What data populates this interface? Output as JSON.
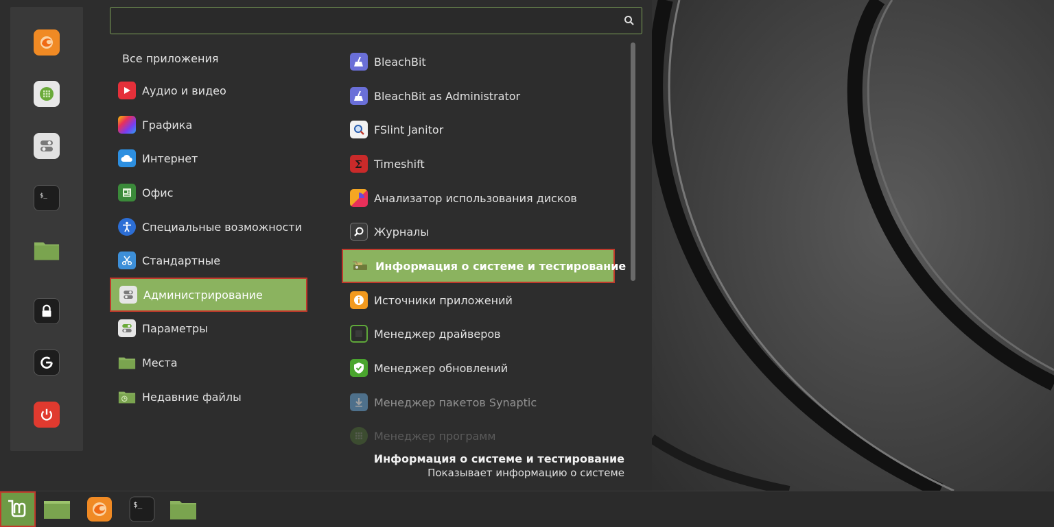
{
  "search": {
    "value": "",
    "placeholder": ""
  },
  "all_apps_label": "Все приложения",
  "categories": [
    {
      "label": "Аудио и видео",
      "icon": "play-icon"
    },
    {
      "label": "Графика",
      "icon": "graphics-icon"
    },
    {
      "label": "Интернет",
      "icon": "cloud-icon"
    },
    {
      "label": "Офис",
      "icon": "office-icon"
    },
    {
      "label": "Специальные возможности",
      "icon": "accessibility-icon"
    },
    {
      "label": "Стандартные",
      "icon": "scissors-icon"
    },
    {
      "label": "Администрирование",
      "icon": "admin-icon",
      "selected": true
    },
    {
      "label": "Параметры",
      "icon": "settings-icon"
    },
    {
      "label": "Места",
      "icon": "folder-icon"
    },
    {
      "label": "Недавние файлы",
      "icon": "recent-folder-icon"
    }
  ],
  "apps": [
    {
      "label": "BleachBit",
      "icon": "broom-icon"
    },
    {
      "label": "BleachBit as Administrator",
      "icon": "broom-icon"
    },
    {
      "label": "FSlint Janitor",
      "icon": "magnifier-doc-icon"
    },
    {
      "label": "Timeshift",
      "icon": "timeshift-icon"
    },
    {
      "label": "Анализатор использования дисков",
      "icon": "disk-usage-icon"
    },
    {
      "label": "Журналы",
      "icon": "logs-icon"
    },
    {
      "label": "Информация о системе и тестирование",
      "icon": "hardinfo-icon",
      "selected": true
    },
    {
      "label": "Источники приложений",
      "icon": "info-icon"
    },
    {
      "label": "Менеджер драйверов",
      "icon": "chip-icon"
    },
    {
      "label": "Менеджер обновлений",
      "icon": "shield-icon"
    },
    {
      "label": "Менеджер пакетов Synaptic",
      "icon": "download-icon"
    },
    {
      "label": "Менеджер программ",
      "icon": "grid-icon"
    }
  ],
  "description": {
    "title": "Информация о системе и тестирование",
    "text": "Показывает информацию о системе"
  },
  "colors": {
    "accent": "#8bb35f",
    "highlight_border": "#c0392b",
    "firefox": "#f08a24",
    "red": "#e03a2f"
  }
}
